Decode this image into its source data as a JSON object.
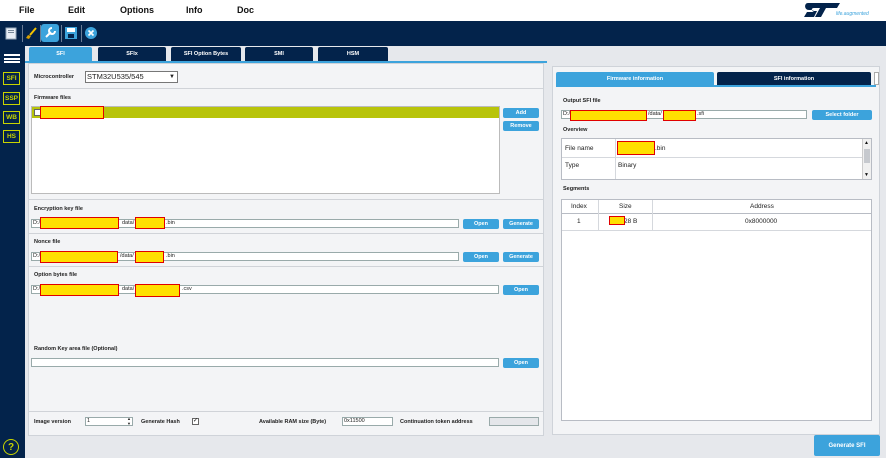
{
  "menu": {
    "file": "File",
    "edit": "Edit",
    "options": "Options",
    "info": "Info",
    "doc": "Doc"
  },
  "brand": {
    "logo": "ST",
    "tagline": "life.augmented"
  },
  "nav": {
    "sfi": "SFI",
    "ssp": "SSP",
    "wb": "WB",
    "hs": "HS",
    "help": "?"
  },
  "tabs": [
    "SFI",
    "SFIx",
    "SFI Option Bytes",
    "SMI",
    "HSM"
  ],
  "left": {
    "microcontroller_label": "Microcontroller",
    "microcontroller_value": "STM32U535/545",
    "firmware_label": "Firmware files",
    "add": "Add",
    "remove": "Remove",
    "enc_label": "Encryption key file",
    "enc_prefix": "D:/",
    "enc_mid": "data/",
    "enc_ext": ".bin",
    "nonce_label": "Nonce file",
    "nonce_prefix": "D:/",
    "nonce_mid": "/data/",
    "nonce_ext": ".bin",
    "ob_label": "Option bytes file",
    "ob_prefix": "D:/",
    "ob_mid": "data/",
    "ob_ext": ".csv",
    "open": "Open",
    "generate": "Generate",
    "rk_label": "Random Key area file (Optional)",
    "image_version_label": "Image version",
    "image_version": "1",
    "generate_hash": "Generate Hash",
    "ram_label": "Available RAM size (Byte)",
    "ram_value": "0x11500",
    "cont_label": "Continuation token address"
  },
  "right": {
    "tab_fw": "Firmware information",
    "tab_sfi": "SFI information",
    "output_label": "Output SFI file",
    "out_prefix": "D:/",
    "out_mid": "/data/",
    "out_ext": ".sfi",
    "select_folder": "Select folder",
    "overview_label": "Overview",
    "ov_rows": [
      {
        "k": "File name",
        "v": ".bin"
      },
      {
        "k": "Type",
        "v": "Binary"
      }
    ],
    "segments_label": "Segments",
    "seg_headers": [
      "Index",
      "Size",
      "Address"
    ],
    "seg_rows": [
      {
        "index": "1",
        "size": "28 B",
        "address": "0x8000000"
      }
    ]
  },
  "footer": {
    "generate_sfi": "Generate SFI"
  },
  "colors": {
    "navy": "#03234b",
    "accent": "#3ca3dc",
    "lime": "#c8d400",
    "redact_fill": "#ffe000",
    "redact_border": "#e00000"
  }
}
